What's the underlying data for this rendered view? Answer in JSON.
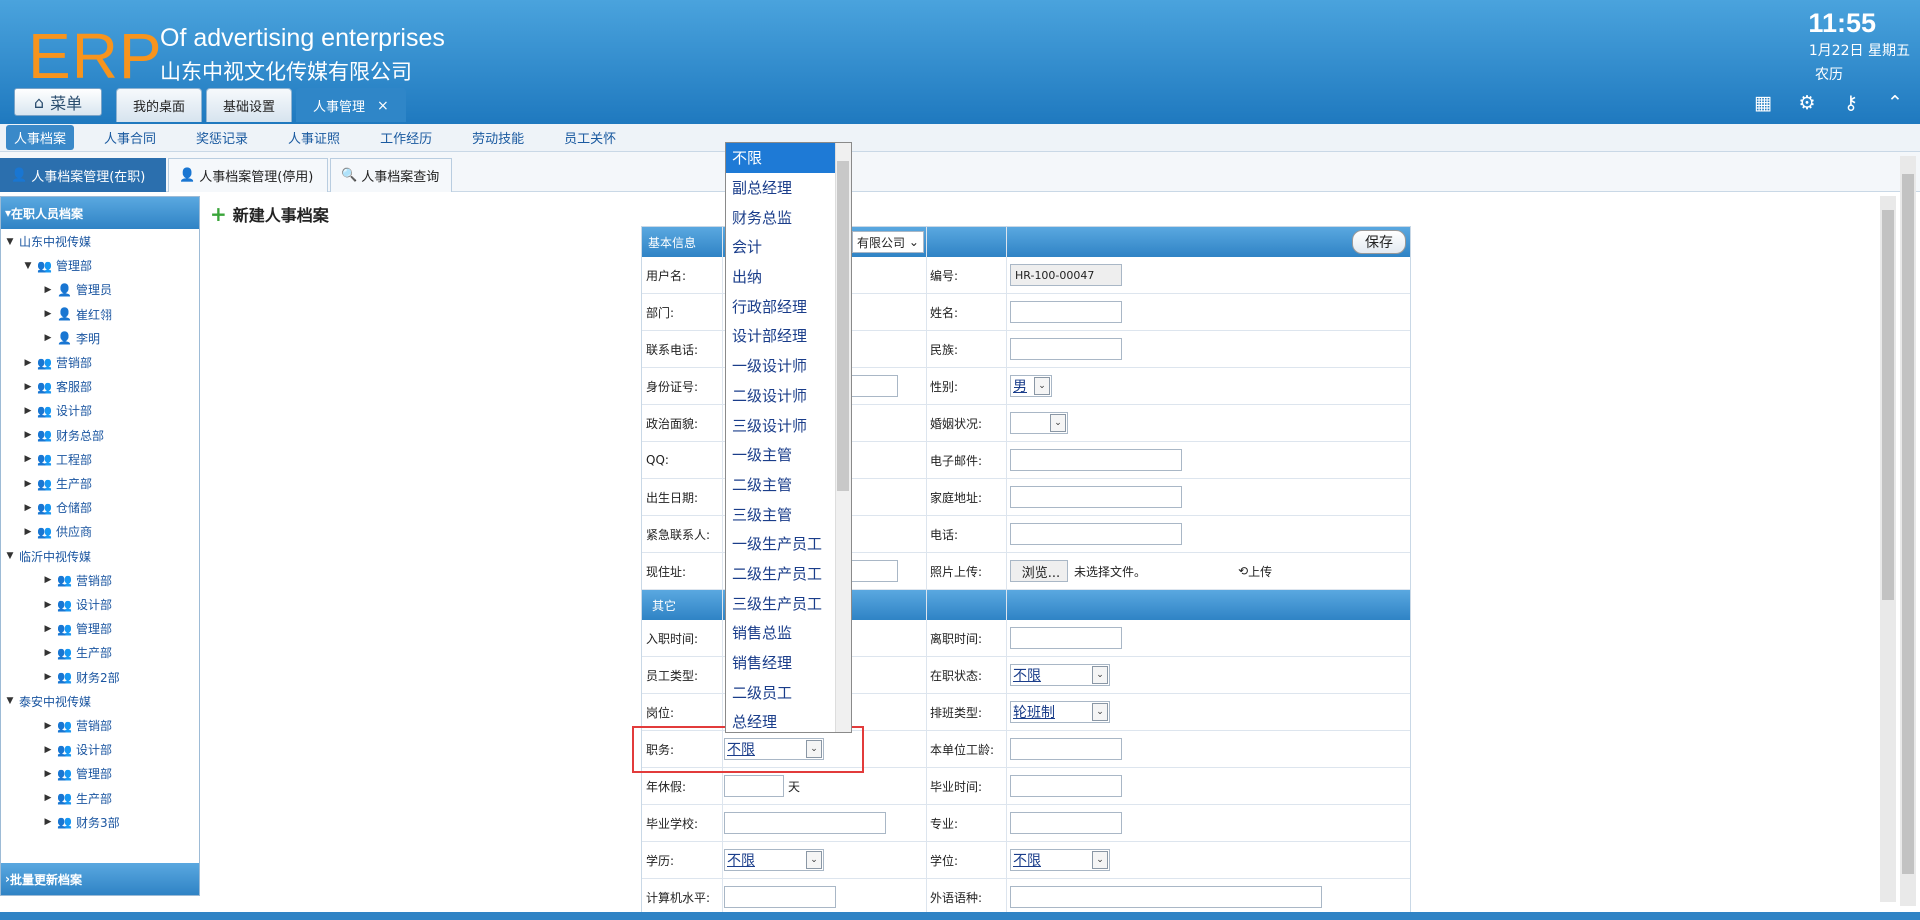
{
  "header": {
    "logo": "ERP",
    "brand_en": "Of advertising enterprises",
    "brand_cn": "山东中视文化传媒有限公司",
    "time": "11:55",
    "date": "1月22日 星期五",
    "lunar": "农历",
    "icons": [
      "grid-icon",
      "gear-icon",
      "key-icon",
      "collapse-icon"
    ]
  },
  "menu": {
    "label": "菜单"
  },
  "top_tabs": [
    {
      "label": "我的桌面"
    },
    {
      "label": "基础设置"
    },
    {
      "label": "人事管理",
      "close": "×"
    }
  ],
  "subnav": [
    "人事档案",
    "人事合同",
    "奖惩记录",
    "人事证照",
    "工作经历",
    "劳动技能",
    "员工关怀"
  ],
  "tabs2": [
    "人事档案管理(在职)",
    "人事档案管理(停用)",
    "人事档案查询"
  ],
  "sidebar": {
    "title": "在职人员档案",
    "footer": "批量更新档案",
    "nodes": [
      {
        "label": "山东中视传媒",
        "level": 0,
        "open": true
      },
      {
        "label": "管理部",
        "level": 1,
        "open": true
      },
      {
        "label": "管理员",
        "level": 2,
        "person": true
      },
      {
        "label": "崔红翎",
        "level": 2,
        "person": true
      },
      {
        "label": "李明",
        "level": 2,
        "person": true
      },
      {
        "label": "营销部",
        "level": 1
      },
      {
        "label": "客服部",
        "level": 1
      },
      {
        "label": "设计部",
        "level": 1
      },
      {
        "label": "财务总部",
        "level": 1
      },
      {
        "label": "工程部",
        "level": 1
      },
      {
        "label": "生产部",
        "level": 1
      },
      {
        "label": "仓储部",
        "level": 1
      },
      {
        "label": "供应商",
        "level": 1
      },
      {
        "label": "临沂中视传媒",
        "level": 0,
        "open": true
      },
      {
        "label": "营销部",
        "level": 2
      },
      {
        "label": "设计部",
        "level": 2
      },
      {
        "label": "管理部",
        "level": 2
      },
      {
        "label": "生产部",
        "level": 2
      },
      {
        "label": "财务2部",
        "level": 2
      },
      {
        "label": "泰安中视传媒",
        "level": 0,
        "open": true
      },
      {
        "label": "营销部",
        "level": 2
      },
      {
        "label": "设计部",
        "level": 2
      },
      {
        "label": "管理部",
        "level": 2
      },
      {
        "label": "生产部",
        "level": 2
      },
      {
        "label": "财务3部",
        "level": 2
      }
    ]
  },
  "page_title": "新建人事档案",
  "form": {
    "section_basic": "基本信息",
    "section_other": "其它",
    "save": "保存",
    "company_partial": "有限公司",
    "labels": {
      "username": "用户名:",
      "number": "编号:",
      "dept": "部门:",
      "name": "姓名:",
      "phone": "联系电话:",
      "ethnic": "民族:",
      "idcard": "身份证号:",
      "gender": "性别:",
      "political": "政治面貌:",
      "marriage": "婚姻状况:",
      "qq": "QQ:",
      "email": "电子邮件:",
      "birthday": "出生日期:",
      "home": "家庭地址:",
      "emergency": "紧急联系人:",
      "tel": "电话:",
      "address": "现住址:",
      "photo": "照片上传:",
      "hire": "入职时间:",
      "leave": "离职时间:",
      "emp_type": "员工类型:",
      "status": "在职状态:",
      "post": "岗位:",
      "shift": "排班类型:",
      "duty": "职务:",
      "seniority": "本单位工龄:",
      "annual": "年休假:",
      "grad_time": "毕业时间:",
      "school": "毕业学校:",
      "major": "专业:",
      "edu": "学历:",
      "degree": "学位:",
      "computer": "计算机水平:",
      "language": "外语语种:"
    },
    "values": {
      "number": "HR-100-00047",
      "gender": "男",
      "status": "不限",
      "shift": "轮班制",
      "duty": "不限",
      "edu": "不限",
      "degree": "不限",
      "annual_unit": "天",
      "browse": "浏览...",
      "no_file": "未选择文件。",
      "upload": "上传"
    }
  },
  "dropdown": {
    "selected": "不限",
    "options": [
      "不限",
      "副总经理",
      "财务总监",
      "会计",
      "出纳",
      "行政部经理",
      "设计部经理",
      "一级设计师",
      "二级设计师",
      "三级设计师",
      "一级主管",
      "二级主管",
      "三级主管",
      "一级生产员工",
      "二级生产员工",
      "三级生产员工",
      "销售总监",
      "销售经理",
      "二级员工",
      "总经理"
    ]
  }
}
